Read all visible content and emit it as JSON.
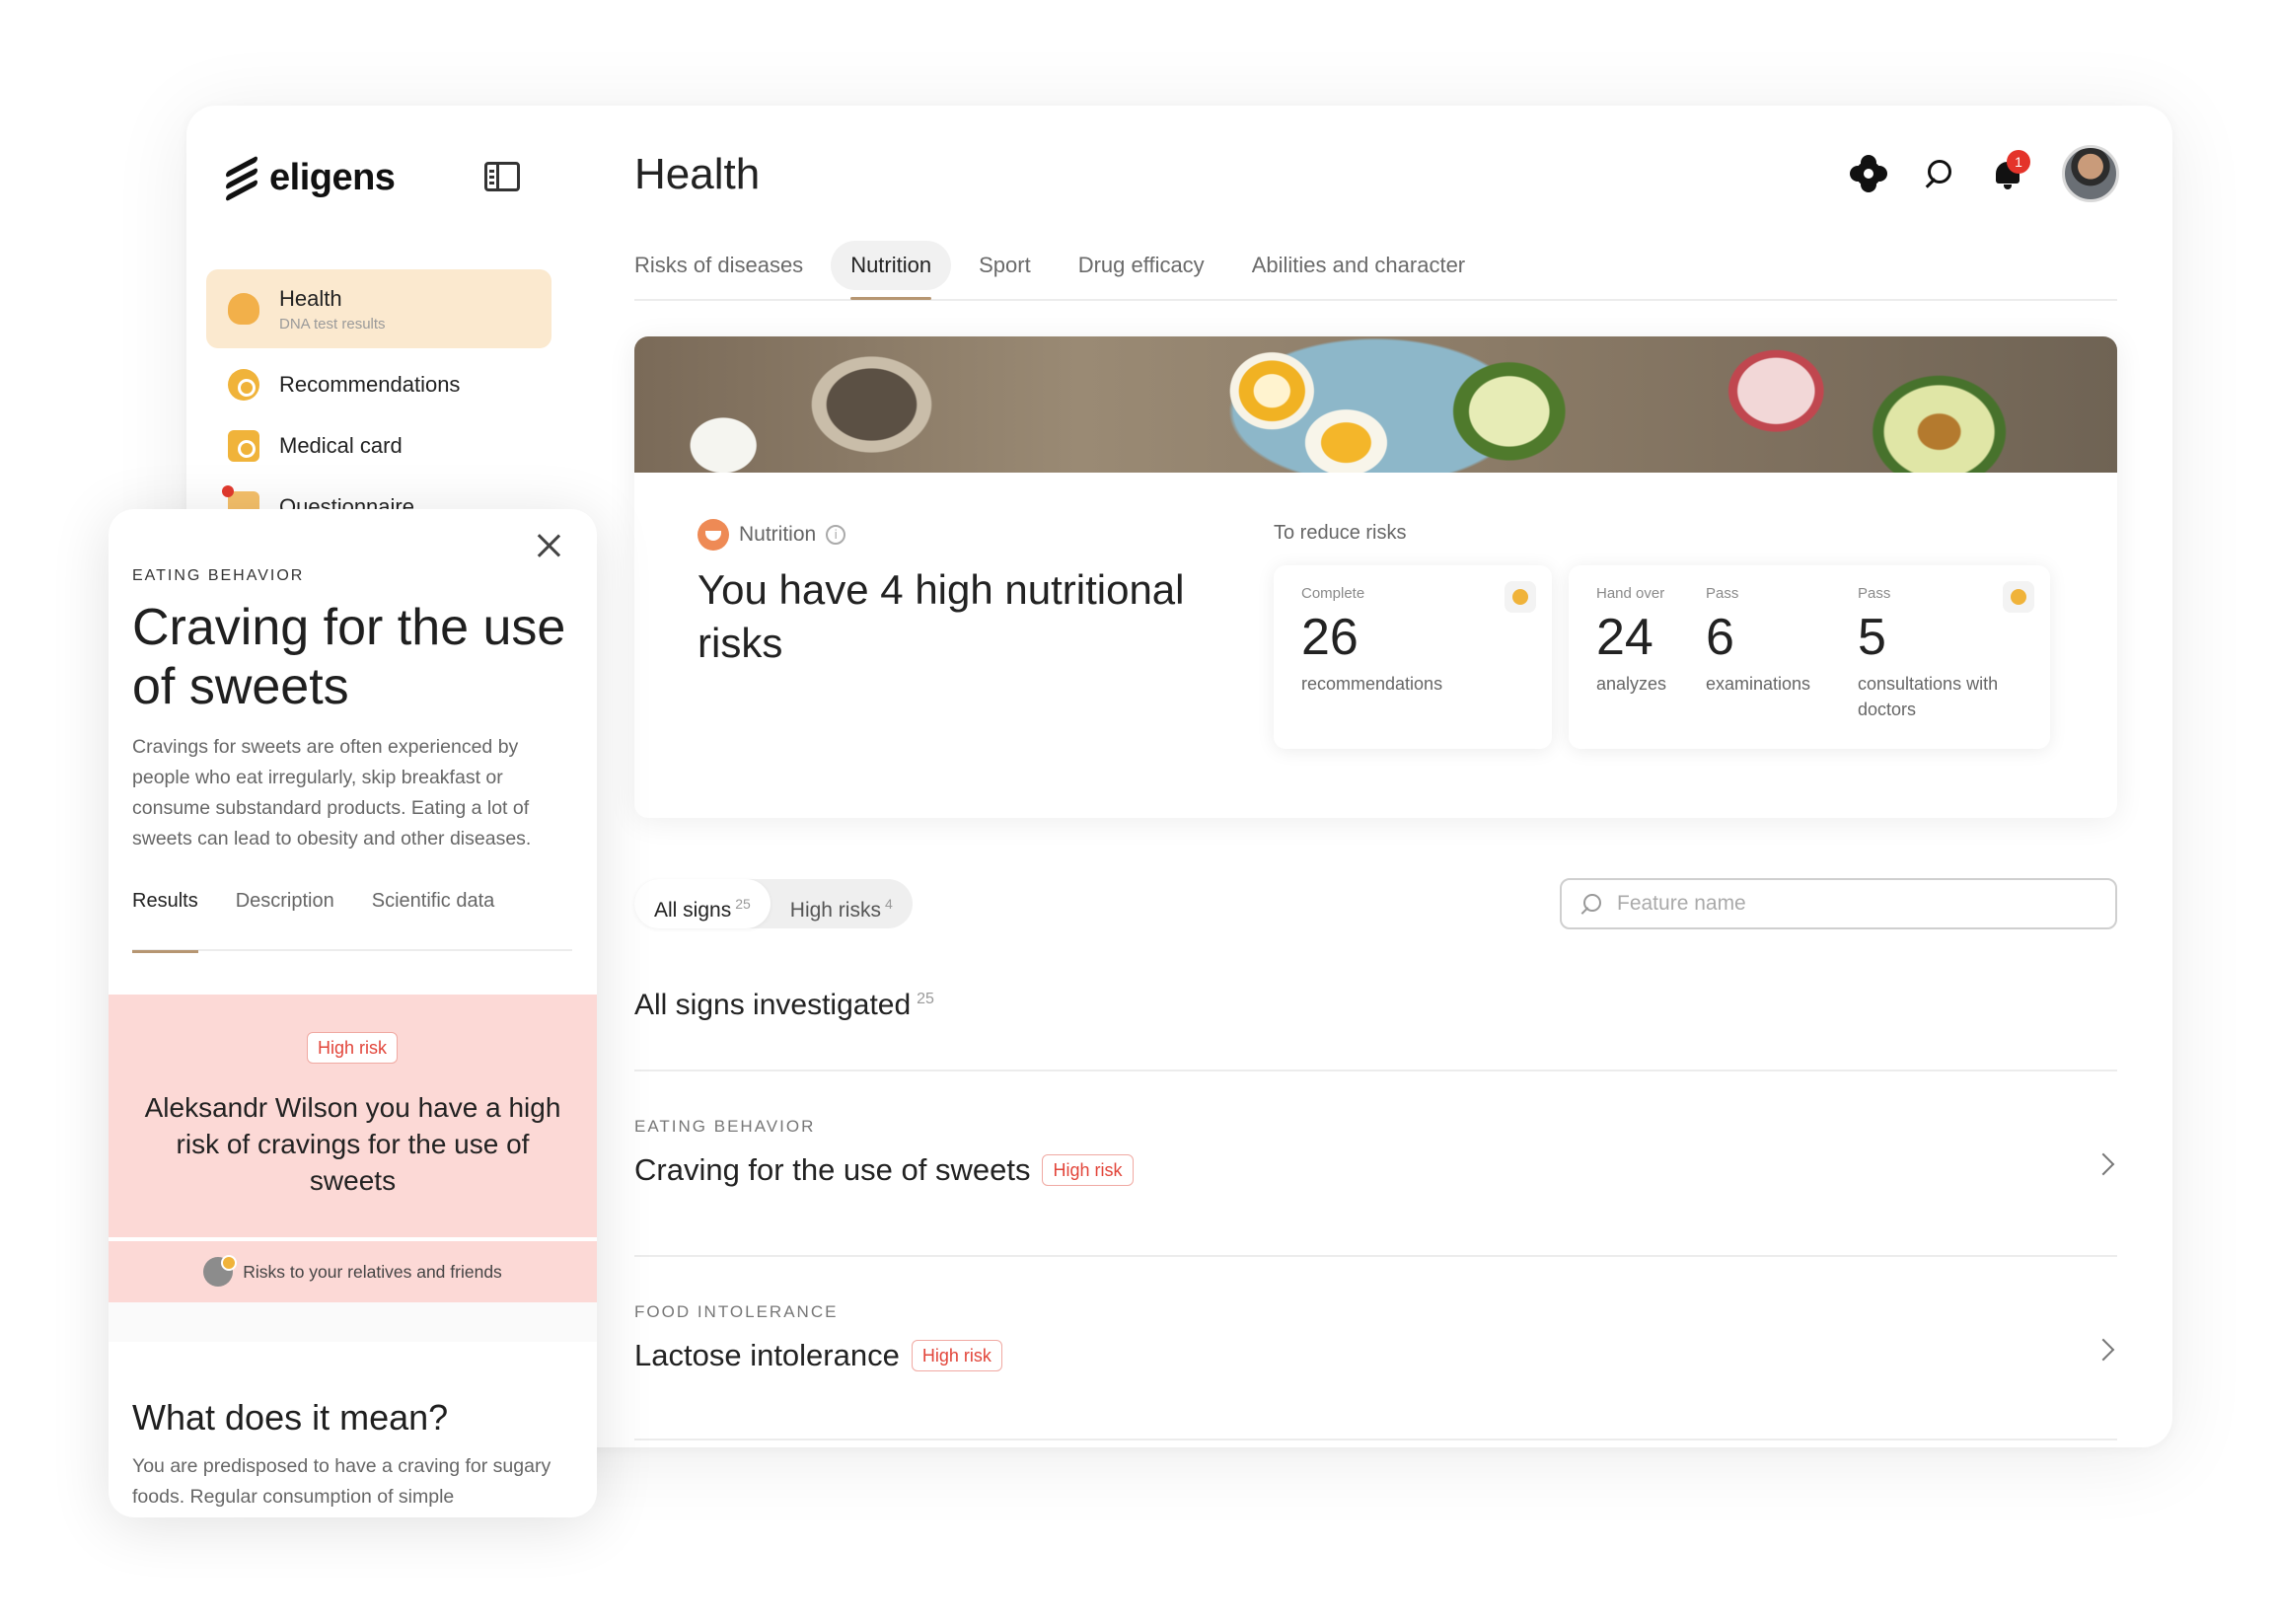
{
  "brand": {
    "name": "eligens"
  },
  "sidebar": {
    "items": [
      {
        "label": "Health",
        "sub": "DNA test results",
        "icon": "heart-icon",
        "active": true
      },
      {
        "label": "Recommendations",
        "icon": "badge-check-icon"
      },
      {
        "label": "Medical card",
        "icon": "medical-card-icon"
      },
      {
        "label": "Questionnaire",
        "icon": "questionnaire-icon"
      }
    ]
  },
  "header": {
    "title": "Health",
    "notifications_count": "1"
  },
  "tabs": [
    {
      "label": "Risks of diseases"
    },
    {
      "label": "Nutrition",
      "active": true
    },
    {
      "label": "Sport"
    },
    {
      "label": "Drug efficacy"
    },
    {
      "label": "Abilities and character"
    }
  ],
  "hero": {
    "category": "Nutrition",
    "title": "You have 4 high nutritional risks",
    "reduce_label": "To reduce risks",
    "card1": {
      "k": "Complete",
      "v": "26",
      "d": "recommendations"
    },
    "card2": [
      {
        "k": "Hand over",
        "v": "24",
        "d": "analyzes"
      },
      {
        "k": "Pass",
        "v": "6",
        "d": "examinations"
      },
      {
        "k": "Pass",
        "v": "5",
        "d": "consultations with doctors"
      }
    ]
  },
  "filters": {
    "all": {
      "label": "All signs",
      "count": "25"
    },
    "high": {
      "label": "High risks",
      "count": "4"
    },
    "search_placeholder": "Feature name"
  },
  "list": {
    "title": "All signs investigated",
    "count": "25",
    "rows": [
      {
        "category": "EATING BEHAVIOR",
        "name": "Craving for the use of sweets",
        "tag": "High risk"
      },
      {
        "category": "FOOD INTOLERANCE",
        "name": "Lactose intolerance",
        "tag": "High risk"
      }
    ]
  },
  "panel": {
    "category": "EATING BEHAVIOR",
    "title": "Craving for the use of sweets",
    "description": "Cravings for sweets are often experienced by people who eat irregularly, skip breakfast or consume substandard products. Eating a lot of sweets can lead to obesity and other diseases.",
    "tabs": [
      "Results",
      "Description",
      "Scientific data"
    ],
    "risk_tag": "High risk",
    "risk_message": "Aleksandr Wilson  you have a high risk of cravings for the use of sweets",
    "relatives": "Risks to your relatives and friends",
    "meaning_title": "What does it mean?",
    "meaning_text": "You are predisposed to have a craving for sugary foods. Regular consumption of simple carbohydrates (sweets, chocolate, sweet"
  },
  "colors": {
    "accent": "#b69672",
    "risk_bg": "#fcd9d6",
    "risk_text": "#e2453a",
    "active_nav": "#fbe9cf"
  }
}
